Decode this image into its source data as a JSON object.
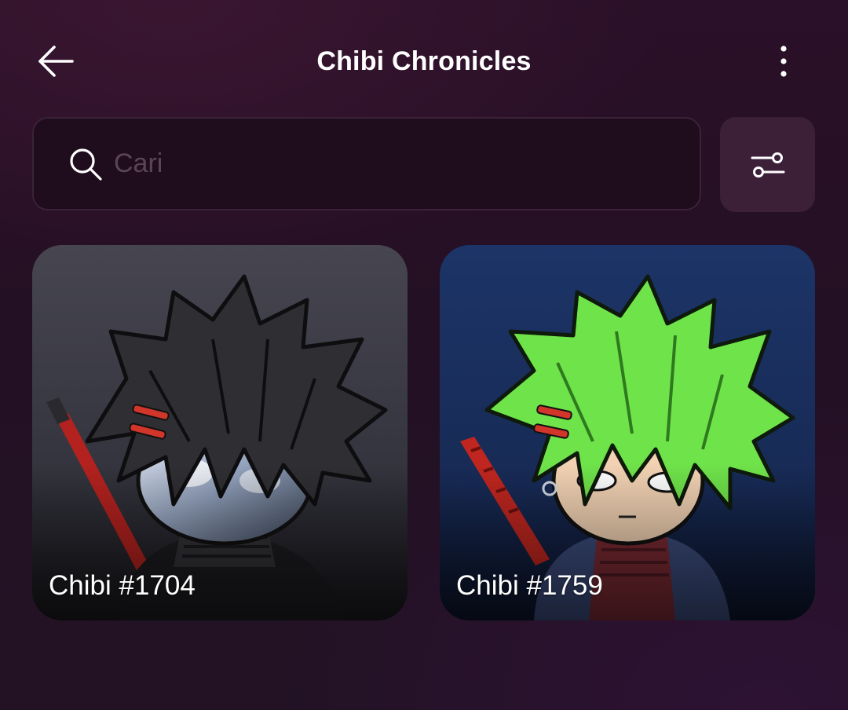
{
  "header": {
    "title": "Chibi Chronicles",
    "back_icon": "arrow-left-icon",
    "menu_icon": "more-vertical-icon"
  },
  "search": {
    "placeholder": "Cari",
    "value": "",
    "icon": "search-icon"
  },
  "filter": {
    "icon": "sliders-icon"
  },
  "items": [
    {
      "name": "Chibi #1704",
      "hair_color": "#2f2f33",
      "background": "#3a3a46"
    },
    {
      "name": "Chibi #1759",
      "hair_color": "#6fe34a",
      "background": "#1b2f62"
    }
  ],
  "colors": {
    "background": "#261126",
    "search_bg": "#1f0c1d",
    "filter_bg": "#3c2038"
  }
}
